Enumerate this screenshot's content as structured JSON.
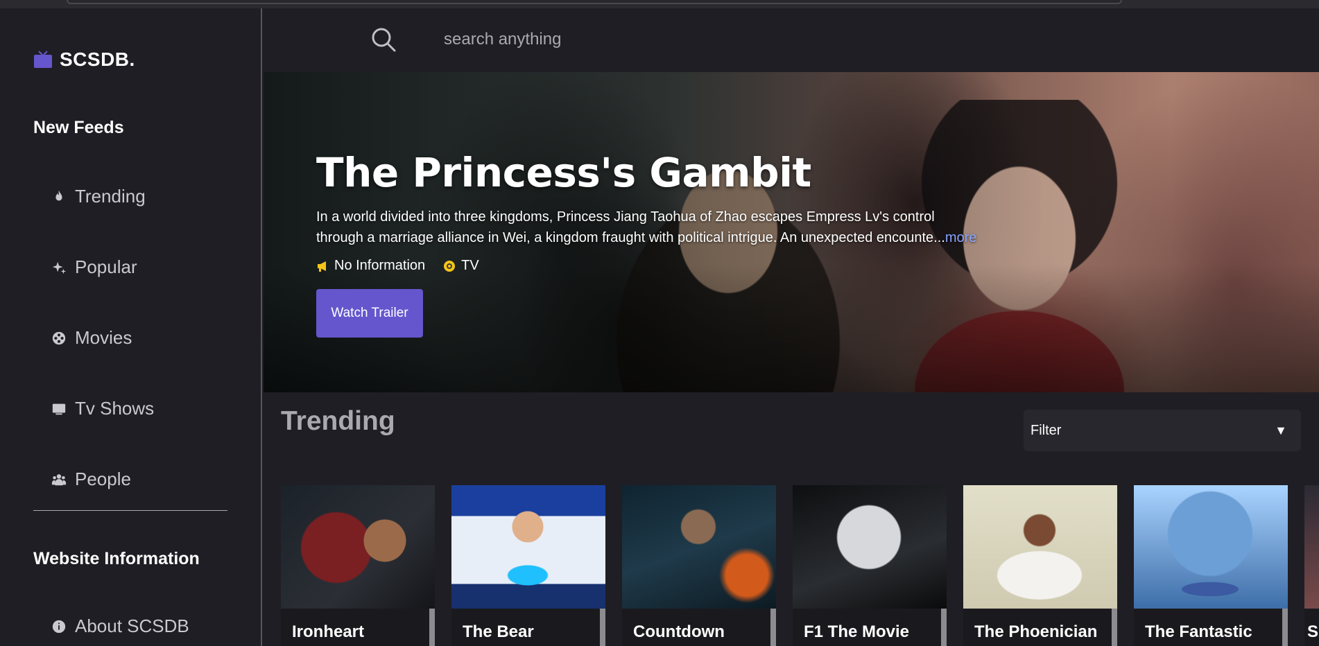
{
  "app": {
    "name": "SCSDB."
  },
  "sidebar": {
    "section_feeds": "New Feeds",
    "items": [
      {
        "label": "Trending",
        "icon": "flame-icon"
      },
      {
        "label": "Popular",
        "icon": "sparkles-icon"
      },
      {
        "label": "Movies",
        "icon": "film-reel-icon"
      },
      {
        "label": "Tv Shows",
        "icon": "tv-icon"
      },
      {
        "label": "People",
        "icon": "people-icon"
      }
    ],
    "section_info": "Website Information",
    "info_items": [
      {
        "label": "About SCSDB",
        "icon": "info-icon"
      }
    ]
  },
  "search": {
    "placeholder": "search anything"
  },
  "hero": {
    "title": "The Princess's Gambit",
    "description": "In a world divided into three kingdoms, Princess Jiang Taohua of Zhao escapes Empress Lv's control through a marriage alliance in Wei, a kingdom fraught with political intrigue. An unexpected encounte...",
    "more": "more",
    "release": "No Information",
    "media_type": "TV",
    "watch_button": "Watch Trailer"
  },
  "trending": {
    "heading": "Trending",
    "filter_label": "Filter",
    "cards": [
      {
        "title": "Ironheart"
      },
      {
        "title": "The Bear"
      },
      {
        "title": "Countdown"
      },
      {
        "title": "F1 The Movie"
      },
      {
        "title": "The Phoenician"
      },
      {
        "title": "The Fantastic"
      },
      {
        "title": "S"
      }
    ]
  },
  "colors": {
    "background": "#1f1e24",
    "accent": "#6556cd",
    "link": "#8aa4ff",
    "meta_icon": "#f5c518"
  }
}
